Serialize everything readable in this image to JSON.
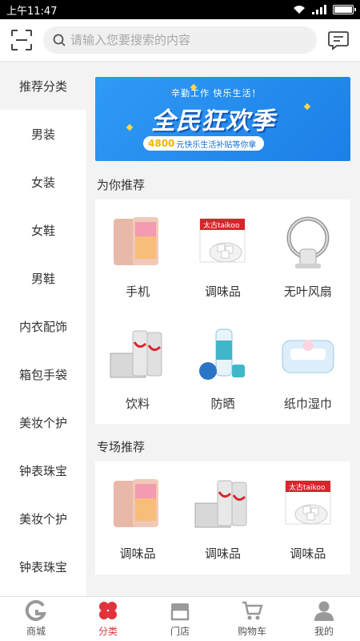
{
  "status_bar": {
    "time": "上午11:47",
    "battery_level": 0.9
  },
  "header": {
    "search_placeholder": "请输入您要搜索的内容"
  },
  "sidebar": {
    "items": [
      {
        "label": "推荐分类",
        "active": true
      },
      {
        "label": "男装"
      },
      {
        "label": "女装"
      },
      {
        "label": "女鞋"
      },
      {
        "label": "男鞋"
      },
      {
        "label": "内衣配饰"
      },
      {
        "label": "箱包手袋"
      },
      {
        "label": "美妆个护"
      },
      {
        "label": "钟表珠宝"
      },
      {
        "label": "美妆个护"
      },
      {
        "label": "钟表珠宝"
      }
    ]
  },
  "banner": {
    "line1": "辛勤工作 快乐生活！",
    "line2": "全民狂欢季",
    "amount": "4800",
    "line3": "元快乐生活补贴等你拿"
  },
  "recommended": {
    "title": "为你推荐",
    "items": [
      {
        "label": "手机",
        "icon": "phone-image"
      },
      {
        "label": "调味品",
        "icon": "sugar-box-image"
      },
      {
        "label": "无叶风扇",
        "icon": "bladeless-fan-image"
      },
      {
        "label": "饮料",
        "icon": "coke-can-image"
      },
      {
        "label": "防晒",
        "icon": "sunscreen-bottle-image"
      },
      {
        "label": "纸巾湿巾",
        "icon": "wet-wipes-image"
      }
    ]
  },
  "special": {
    "title": "专场推荐",
    "items": [
      {
        "label": "调味品",
        "icon": "phone-image"
      },
      {
        "label": "调味品",
        "icon": "coke-can-image"
      },
      {
        "label": "调味品",
        "icon": "sugar-box-image"
      }
    ]
  },
  "tabbar": {
    "items": [
      {
        "label": "商城",
        "icon": "mall-icon"
      },
      {
        "label": "分类",
        "icon": "category-icon",
        "active": true
      },
      {
        "label": "门店",
        "icon": "store-icon"
      },
      {
        "label": "购物车",
        "icon": "cart-icon"
      },
      {
        "label": "我的",
        "icon": "user-icon"
      }
    ]
  },
  "colors": {
    "accent": "#e0333b",
    "banner_blue": "#1c7fe8"
  }
}
